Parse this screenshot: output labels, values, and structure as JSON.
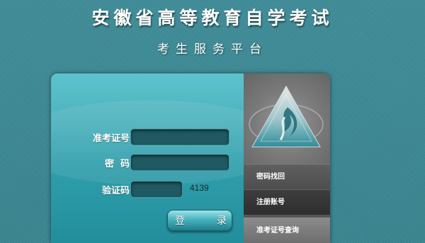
{
  "header": {
    "title": "安徽省高等教育自学考试",
    "subtitle": "考生服务平台"
  },
  "login_form": {
    "ticket_label": "准考证号：",
    "ticket_value": "",
    "password_label": "密  码：",
    "password_value": "",
    "captcha_label": "验证码：",
    "captcha_value": "",
    "captcha_code": "4139",
    "login_button": "登  录"
  },
  "sidebar": {
    "logo": "provincial-exam-logo-icon",
    "items": [
      {
        "label": "密码找回"
      },
      {
        "label": "注册账号"
      },
      {
        "label": "准考证号查询"
      }
    ]
  },
  "colors": {
    "background": "#3d8a96",
    "panel_left": "#4fb4bf",
    "panel_right": "#6b6b6b",
    "field": "#1f5a62"
  }
}
